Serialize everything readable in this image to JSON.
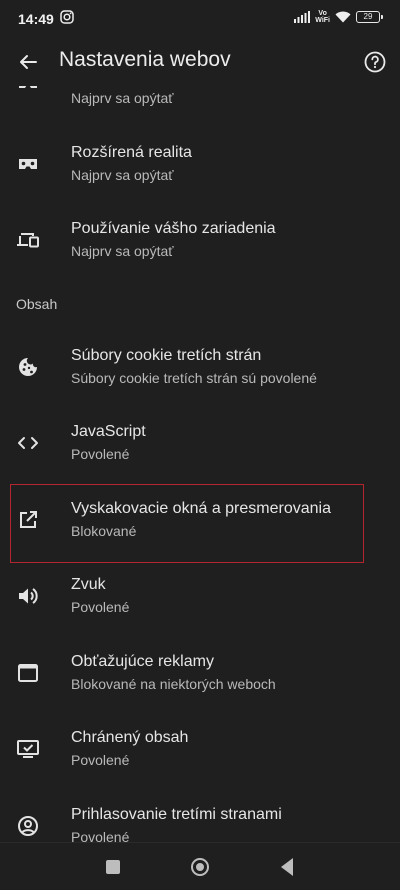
{
  "status_bar": {
    "time": "14:49",
    "vowifi_top": "Vo",
    "vowifi_bottom": "WiFi",
    "battery": "29"
  },
  "toolbar": {
    "title": "Nastavenia webov"
  },
  "section": {
    "content_header": "Obsah"
  },
  "items": [
    {
      "title": "",
      "subtitle": "Najprv sa opýtať",
      "icon": "vr-headset-icon"
    },
    {
      "title": "Rozšírená realita",
      "subtitle": "Najprv sa opýtať",
      "icon": "ar-headset-icon"
    },
    {
      "title": "Používanie vášho zariadenia",
      "subtitle": "Najprv sa opýtať",
      "icon": "devices-icon"
    },
    {
      "title": "Súbory cookie tretích strán",
      "subtitle": "Súbory cookie tretích strán sú povolené",
      "icon": "cookie-icon"
    },
    {
      "title": "JavaScript",
      "subtitle": "Povolené",
      "icon": "code-icon"
    },
    {
      "title": "Vyskakovacie okná a presmerovania",
      "subtitle": "Blokované",
      "icon": "open-in-new-icon"
    },
    {
      "title": "Zvuk",
      "subtitle": "Povolené",
      "icon": "volume-icon"
    },
    {
      "title": "Obťažujúce reklamy",
      "subtitle": "Blokované na niektorých weboch",
      "icon": "ad-window-icon"
    },
    {
      "title": "Chránený obsah",
      "subtitle": "Povolené",
      "icon": "protected-content-icon"
    },
    {
      "title": "Prihlasovanie tretími stranami",
      "subtitle": "Povolené",
      "icon": "account-circle-icon"
    }
  ],
  "colors": {
    "background": "#1f1f1f",
    "highlight_border": "#b3262f",
    "text": "#e3e3e3"
  }
}
